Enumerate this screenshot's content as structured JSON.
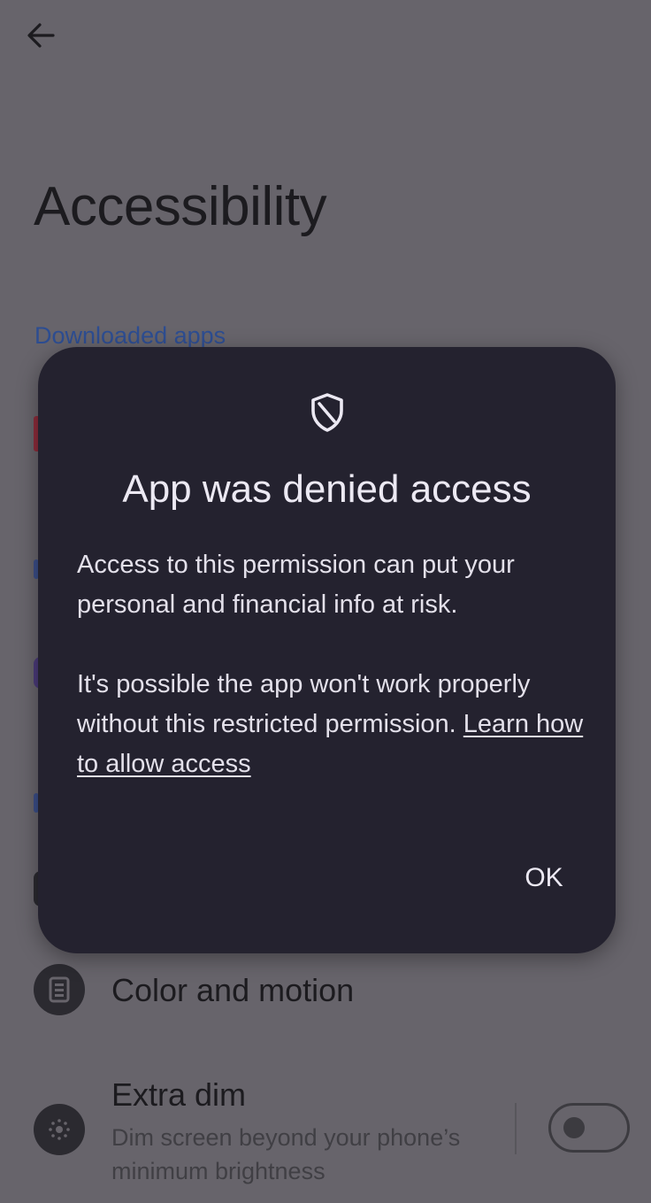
{
  "app_bar": {
    "back_icon": "arrow-back-icon"
  },
  "page": {
    "title": "Accessibility",
    "section_label": "Downloaded apps"
  },
  "rows": [
    {
      "icon": "color-motion-icon",
      "title": "Color and motion"
    },
    {
      "icon": "extra-dim-icon",
      "title": "Extra dim",
      "subtitle": "Dim screen beyond your phone’s minimum brightness",
      "toggle_on": false
    }
  ],
  "dialog": {
    "icon": "shield-icon",
    "title": "App was denied access",
    "body_1": "Access to this permission can put your personal and financial info at risk.",
    "body_2": "It's possible the app won't work properly without this restricted permission.",
    "link_text": "Learn how to allow access",
    "ok_label": "OK"
  },
  "colors": {
    "scrim_background": "#67646b",
    "dialog_background": "#24222f",
    "accent_link": "#2d4d91",
    "dialog_text": "#ece9f3"
  }
}
